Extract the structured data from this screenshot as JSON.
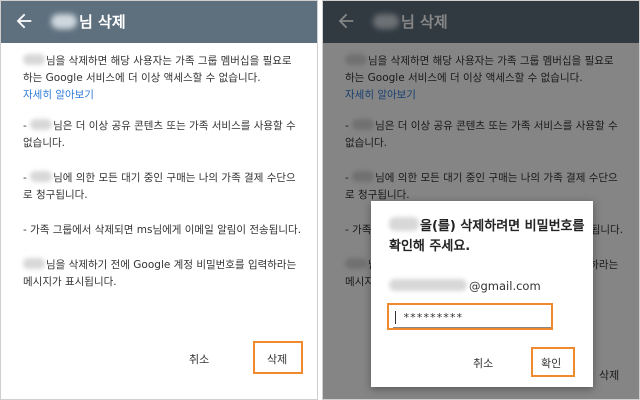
{
  "left_screen": {
    "title_suffix": "님 삭제",
    "paragraph_1": "님을 삭제하면 해당 사용자는 가족 그룹 멤버십을 필요로 하는 Google 서비스에 더 이상 액세스할 수 없습니다.",
    "learn_more_link": "자세히 알아보기",
    "bullet_1_prefix": "- ",
    "bullet_1": "님은 더 이상 공유 콘텐츠 또는 가족 서비스를 사용할 수 없습니다.",
    "bullet_2_prefix": "- ",
    "bullet_2": "님에 의한 모든 대기 중인 구매는 나의 가족 결제 수단으로 청구됩니다.",
    "bullet_3": "- 가족 그룹에서 삭제되면 ms님에게 이메일 알림이 전송됩니다.",
    "paragraph_2": "님을 삭제하기 전에 Google 계정 비밀번호를 입력하라는 메시지가 표시됩니다.",
    "cancel_label": "취소",
    "delete_label": "삭제"
  },
  "right_screen": {
    "title_suffix": "님 삭제",
    "dialog_title": "을(를) 삭제하려면 비밀번호를 확인해 주세요.",
    "email_suffix": "@gmail.com",
    "password_value": "*********",
    "cancel_label": "취소",
    "confirm_label": "확인",
    "behind_delete_label": "삭제"
  },
  "colors": {
    "appbar": "#5e6f7e",
    "link": "#2f7bd8",
    "highlight": "#ef8b2e"
  }
}
